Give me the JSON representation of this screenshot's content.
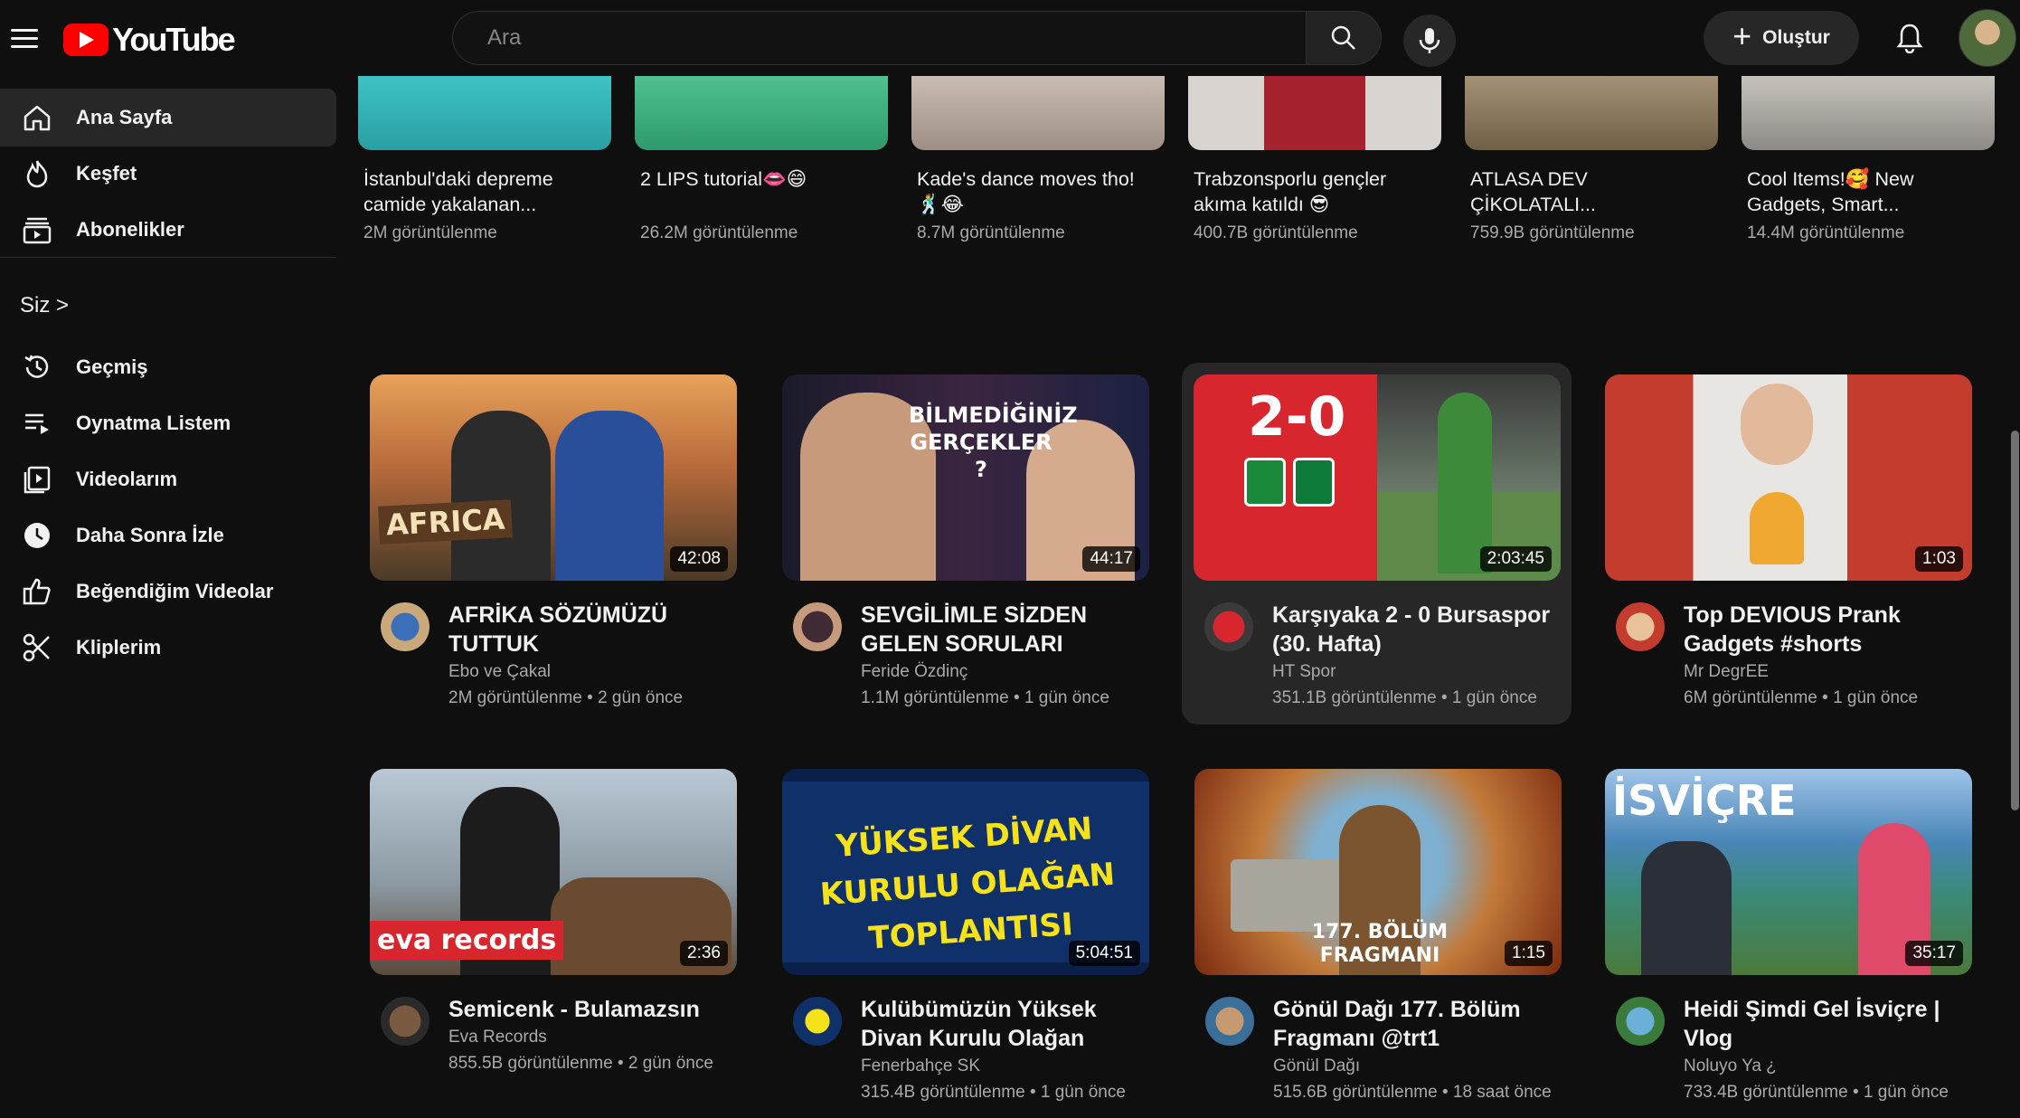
{
  "header": {
    "logo_text": "YouTube",
    "search_placeholder": "Ara",
    "create_label": "Oluştur"
  },
  "sidebar": {
    "items": [
      {
        "label": "Ana Sayfa",
        "icon": "home-icon"
      },
      {
        "label": "Keşfet",
        "icon": "flame-icon"
      },
      {
        "label": "Abonelikler",
        "icon": "subscriptions-icon"
      }
    ],
    "you_header": "Siz >",
    "you_items": [
      {
        "label": "Geçmiş",
        "icon": "history-icon"
      },
      {
        "label": "Oynatma Listem",
        "icon": "playlist-icon"
      },
      {
        "label": "Videolarım",
        "icon": "my-videos-icon"
      },
      {
        "label": "Daha Sonra İzle",
        "icon": "watch-later-icon"
      },
      {
        "label": "Beğendiğim Videolar",
        "icon": "thumbs-up-icon"
      },
      {
        "label": "Kliplerim",
        "icon": "scissors-icon"
      }
    ]
  },
  "shorts": [
    {
      "title": "İstanbul'daki depreme camide yakalanan...",
      "views": "2M görüntülenme",
      "color": "#2aa6a9"
    },
    {
      "title": "2 LIPS tutorial👄😄",
      "views": "26.2M görüntülenme",
      "color": "#3daa7d"
    },
    {
      "title": "Kade's dance moves tho! 🕺😂",
      "views": "8.7M görüntülenme",
      "color": "#b7a79c"
    },
    {
      "title": "Trabzonsporlu gençler akıma katıldı 😎",
      "views": "400.7B görüntülenme",
      "color": "#b7373f"
    },
    {
      "title": "ATLASA DEV ÇİKOLATALI...",
      "views": "759.9B görüntülenme",
      "color": "#8a7a5e"
    },
    {
      "title": "Cool Items!🥰 New Gadgets, Smart...",
      "views": "14.4M görüntülenme",
      "color": "#b9b6b0"
    }
  ],
  "videos": [
    {
      "title": "AFRİKA SÖZÜMÜZÜ TUTTUK",
      "channel": "Ebo ve Çakal",
      "meta": "2M görüntülenme • 2 gün önce",
      "duration": "42:08",
      "thumb_text": "AFRICA"
    },
    {
      "title": "SEVGİLİMLE SİZDEN GELEN SORULARI",
      "channel": "Feride Özdinç",
      "meta": "1.1M görüntülenme • 1 gün önce",
      "duration": "44:17",
      "thumb_text": "BİLMEDİĞİNİZ GERÇEKLER ?"
    },
    {
      "title": "Karşıyaka 2 - 0 Bursaspor (30. Hafta)",
      "channel": "HT Spor",
      "meta": "351.1B görüntülenme • 1 gün önce",
      "duration": "2:03:45",
      "thumb_text": "2-0"
    },
    {
      "title": "Top DEVIOUS Prank Gadgets #shorts",
      "channel": "Mr DegrEE",
      "meta": "6M görüntülenme • 1 gün önce",
      "duration": "1:03",
      "thumb_text": ""
    },
    {
      "title": "Semicenk - Bulamazsın",
      "channel": "Eva Records",
      "meta": "855.5B görüntülenme • 2 gün önce",
      "duration": "2:36",
      "thumb_text": "eva records"
    },
    {
      "title": "Kulübümüzün Yüksek Divan Kurulu Olağan",
      "channel": "Fenerbahçe SK",
      "meta": "315.4B görüntülenme • 1 gün önce",
      "duration": "5:04:51",
      "thumb_text": "YÜKSEK DİVAN KURULU OLAĞAN TOPLANTISI"
    },
    {
      "title": "Gönül Dağı 177. Bölüm Fragmanı @trt1",
      "channel": "Gönül Dağı",
      "meta": "515.6B görüntülenme • 18 saat önce",
      "duration": "1:15",
      "thumb_text": "177. BÖLÜM FRAGMANI"
    },
    {
      "title": "Heidi Şimdi Gel İsviçre | Vlog",
      "channel": "Noluyo Ya ¿",
      "meta": "733.4B görüntülenme • 1 gün önce",
      "duration": "35:17",
      "thumb_text": "İSVİÇRE"
    }
  ]
}
